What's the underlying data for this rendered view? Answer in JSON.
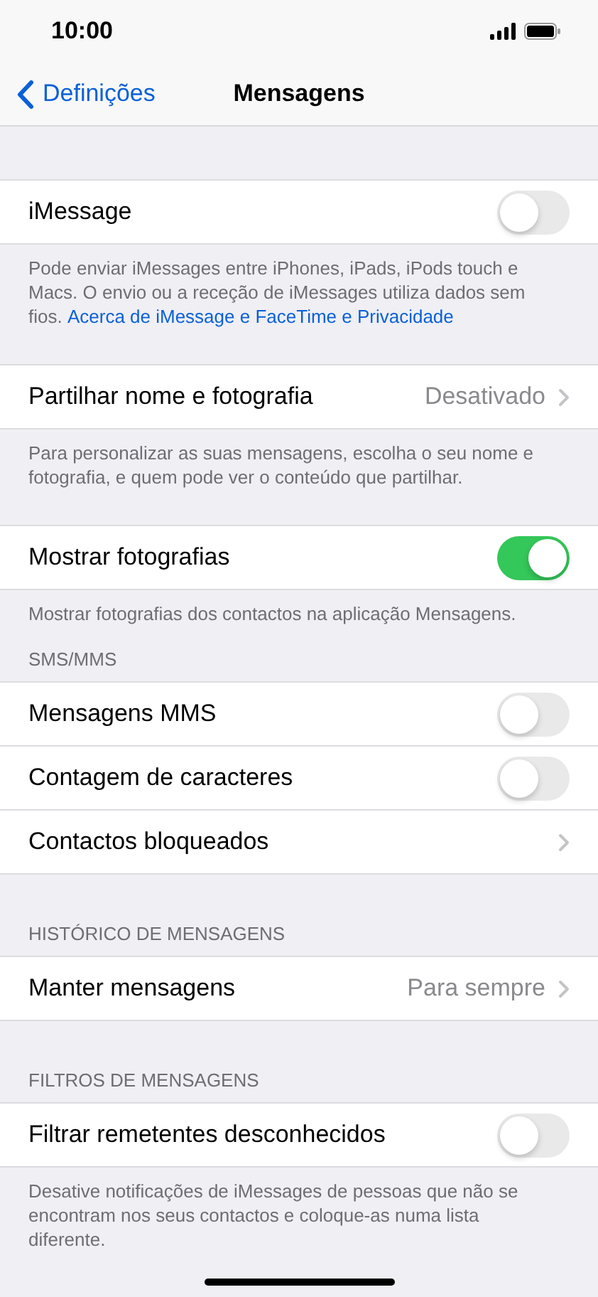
{
  "status_bar": {
    "time": "10:00"
  },
  "nav": {
    "back": "Definições",
    "title": "Mensagens"
  },
  "sections": [
    {
      "rows": [
        {
          "kind": "toggle",
          "label": "iMessage",
          "on": false
        }
      ],
      "footer": {
        "text": "Pode enviar iMessages entre iPhones, iPads, iPods touch e Macs. O envio ou a receção de iMessages utiliza dados sem fios.",
        "link": "Acerca de iMessage e FaceTime e Privacidade"
      }
    },
    {
      "rows": [
        {
          "kind": "disclosure",
          "label": "Partilhar nome e fotografia",
          "value": "Desativado"
        }
      ],
      "footer": {
        "text": "Para personalizar as suas mensagens, escolha o seu nome e fotografia, e quem pode ver o conteúdo que partilhar."
      }
    },
    {
      "rows": [
        {
          "kind": "toggle",
          "label": "Mostrar fotografias",
          "on": true
        }
      ],
      "footer": {
        "text": "Mostrar fotografias dos contactos na aplicação Mensagens."
      }
    },
    {
      "header": "SMS/MMS",
      "rows": [
        {
          "kind": "toggle",
          "label": "Mensagens MMS",
          "on": false
        },
        {
          "kind": "toggle",
          "label": "Contagem de caracteres",
          "on": false
        },
        {
          "kind": "disclosure",
          "label": "Contactos bloqueados"
        }
      ]
    },
    {
      "header": "HISTÓRICO DE MENSAGENS",
      "rows": [
        {
          "kind": "disclosure",
          "label": "Manter mensagens",
          "value": "Para sempre"
        }
      ]
    },
    {
      "header": "FILTROS DE MENSAGENS",
      "rows": [
        {
          "kind": "toggle",
          "label": "Filtrar remetentes desconhecidos",
          "on": false
        }
      ],
      "footer": {
        "text": "Desative notificações de iMessages de pessoas que não se encontram nos seus contactos e coloque-as numa lista diferente."
      }
    }
  ]
}
